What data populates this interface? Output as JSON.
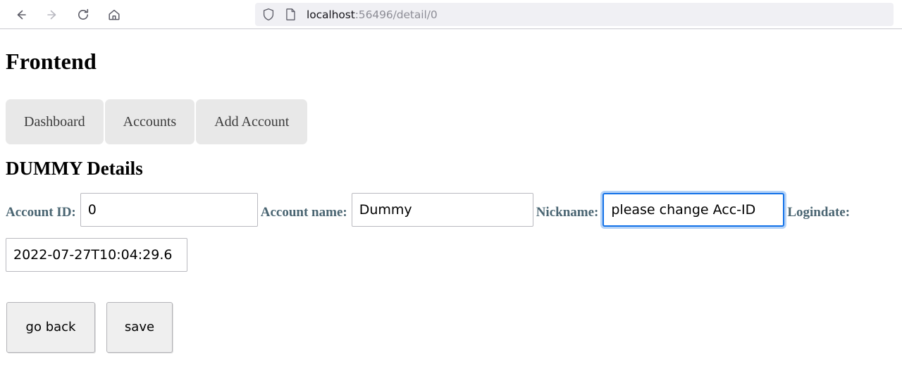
{
  "browser": {
    "nav_buttons": [
      {
        "name": "back-button",
        "icon": "arrow-left-icon",
        "enabled": true
      },
      {
        "name": "forward-button",
        "icon": "arrow-right-icon",
        "enabled": false
      },
      {
        "name": "reload-button",
        "icon": "reload-icon",
        "enabled": true
      },
      {
        "name": "home-button",
        "icon": "home-icon",
        "enabled": true
      }
    ],
    "url": {
      "host": "localhost",
      "rest": ":56496/detail/0",
      "full": "localhost:56496/detail/0",
      "shield_icon": "shield-icon",
      "page_icon": "page-document-icon"
    }
  },
  "page": {
    "app_title": "Frontend",
    "nav": [
      {
        "label": "Dashboard"
      },
      {
        "label": "Accounts"
      },
      {
        "label": "Add Account"
      }
    ],
    "detail_title": "DUMMY Details",
    "fields": [
      {
        "label": "Account ID:",
        "value": "0"
      },
      {
        "label": "Account name:",
        "value": "Dummy"
      },
      {
        "label": "Nickname:",
        "value": "please change Acc-ID",
        "focused": true
      },
      {
        "label": "Logindate:",
        "value": "2022-07-27T10:04:29.6"
      }
    ],
    "buttons": [
      {
        "label": "go back"
      },
      {
        "label": "save"
      }
    ]
  },
  "colors": {
    "accent_focus": "#1372e8",
    "focus_glow": "#b6d3f7",
    "label_text": "#4a6572",
    "nav_pill_bg": "#e8e8e8",
    "urlbar_bg": "#f0f0f4",
    "button_bg": "#efefef"
  }
}
